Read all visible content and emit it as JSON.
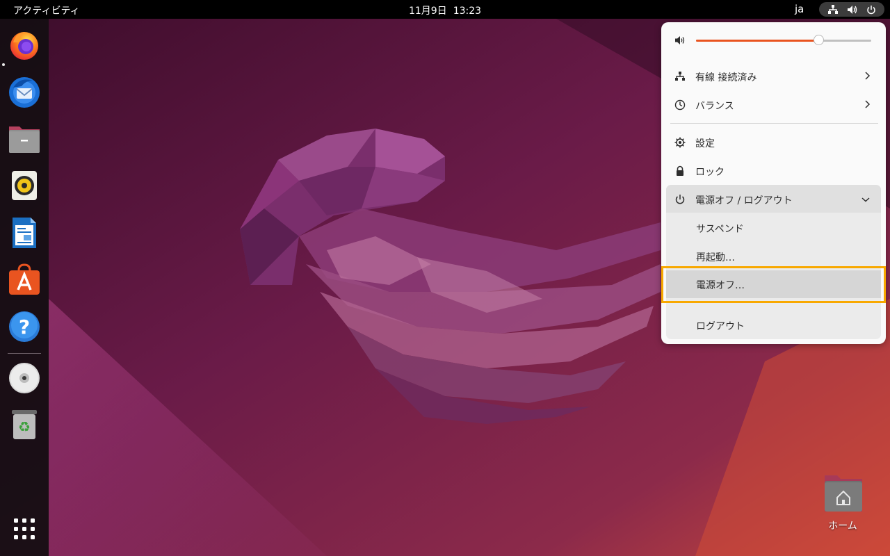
{
  "topbar": {
    "activities_label": "アクティビティ",
    "date": "11月9日",
    "time": "13:23",
    "input_language": "ja",
    "tray_icons": [
      "network-wired-icon",
      "volume-icon",
      "power-icon"
    ]
  },
  "dock": {
    "apps": [
      {
        "name": "Firefox",
        "icon": "firefox-icon",
        "running": true
      },
      {
        "name": "Thunderbird",
        "icon": "thunderbird-icon",
        "running": false
      },
      {
        "name": "Files",
        "icon": "files-icon",
        "running": false
      },
      {
        "name": "Rhythmbox",
        "icon": "rhythmbox-icon",
        "running": false
      },
      {
        "name": "LibreOffice Writer",
        "icon": "writer-icon",
        "running": false
      },
      {
        "name": "Ubuntu Software",
        "icon": "software-icon",
        "running": false
      },
      {
        "name": "Help",
        "icon": "help-icon",
        "running": false
      },
      {
        "name": "Disc",
        "icon": "cd-icon",
        "running": false
      },
      {
        "name": "Trash",
        "icon": "trash-icon",
        "running": false
      }
    ],
    "show_apps_icon": "app-grid-icon"
  },
  "desktop": {
    "home_label": "ホーム"
  },
  "menu": {
    "volume_level": 0.7,
    "network_label": "有線 接続済み",
    "power_mode_label": "バランス",
    "settings_label": "設定",
    "lock_label": "ロック",
    "power_section_label": "電源オフ / ログアウト",
    "submenu": {
      "suspend_label": "サスペンド",
      "restart_label": "再起動…",
      "poweroff_label": "電源オフ…",
      "logout_label": "ログアウト"
    },
    "selected_item": "poweroff"
  },
  "colors": {
    "accent": "#e95420",
    "highlight": "#f8a800",
    "topbar": "#000000"
  }
}
